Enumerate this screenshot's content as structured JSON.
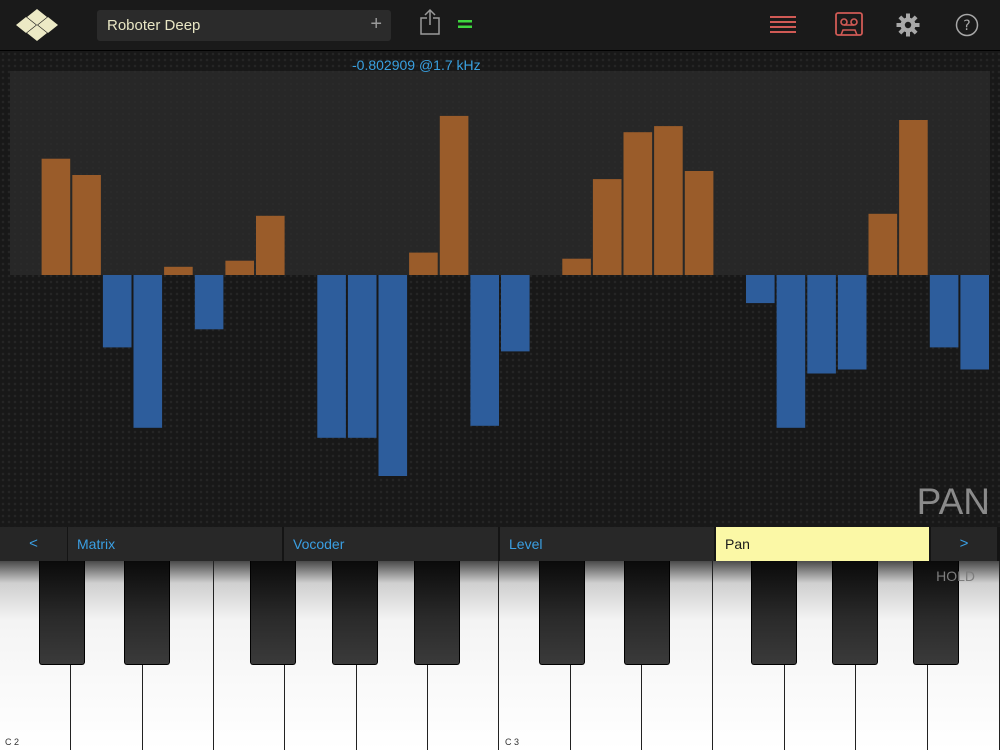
{
  "header": {
    "preset_name": "Roboter Deep",
    "add_label": "+",
    "icons": [
      "app-logo-icon",
      "share-icon",
      "equal-icon",
      "list-icon",
      "tape-icon",
      "gear-icon",
      "help-icon"
    ]
  },
  "display": {
    "readout": "-0.802909 @1.7 kHz",
    "mode_label": "PAN"
  },
  "chart_data": {
    "type": "bar",
    "title": "",
    "ylim": [
      -1,
      1
    ],
    "colors": {
      "positive": "#9a5c2a",
      "negative": "#2d5d9c",
      "upper_panel": "#2c2c2c"
    },
    "values": [
      0,
      0.57,
      0.49,
      -0.36,
      -0.76,
      0.04,
      -0.27,
      0.07,
      0.29,
      0,
      -0.81,
      -0.81,
      -1.0,
      0.11,
      0.78,
      -0.75,
      -0.38,
      0,
      0.08,
      0.47,
      0.7,
      0.73,
      0.51,
      0,
      -0.14,
      -0.76,
      -0.49,
      -0.47,
      0.3,
      0.76,
      -0.36,
      -0.47
    ]
  },
  "tabs": {
    "prev_label": "<",
    "next_label": ">",
    "items": [
      {
        "label": "Matrix",
        "active": false
      },
      {
        "label": "Vocoder",
        "active": false
      },
      {
        "label": "Level",
        "active": false
      },
      {
        "label": "Pan",
        "active": true
      }
    ],
    "hold_label": "HOLD"
  },
  "keyboard": {
    "octave_labels": [
      "C 2",
      "C 3"
    ]
  }
}
